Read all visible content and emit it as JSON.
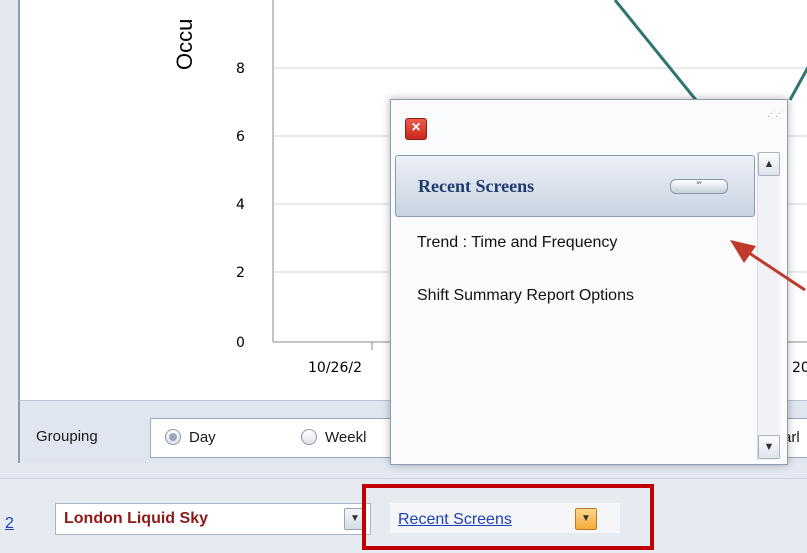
{
  "chart": {
    "y_axis_title": "Occu",
    "y_ticks": [
      "0",
      "2",
      "4",
      "6",
      "8"
    ],
    "x_ticks": [
      "10/26/2",
      "20"
    ],
    "line_color": "#2f7570"
  },
  "grouping": {
    "label": "Grouping",
    "options": [
      {
        "label": "Day",
        "checked": true
      },
      {
        "label": "Weekl",
        "checked": false
      },
      {
        "label": "arl",
        "checked": false
      }
    ]
  },
  "bottom_bar": {
    "left_fragment": "2",
    "location_value": "London Liquid Sky",
    "recent_screens_link": "Recent Screens"
  },
  "popup": {
    "header_title": "Recent Screens",
    "pin_label": "′′′",
    "items": [
      "Trend : Time and Frequency",
      "Shift Summary Report Options"
    ]
  },
  "colors": {
    "highlight": "#c00000",
    "annotation_arrow": "#c0392b",
    "header_text": "#1f3b6e",
    "location_text": "#8b1a1a",
    "link": "#1f3fb3"
  },
  "icons": {
    "close": "close-icon",
    "scroll_up": "chevron-up-icon",
    "scroll_down": "chevron-down-icon",
    "combo_arrow": "chevron-down-icon",
    "grip": "resize-grip-icon"
  }
}
